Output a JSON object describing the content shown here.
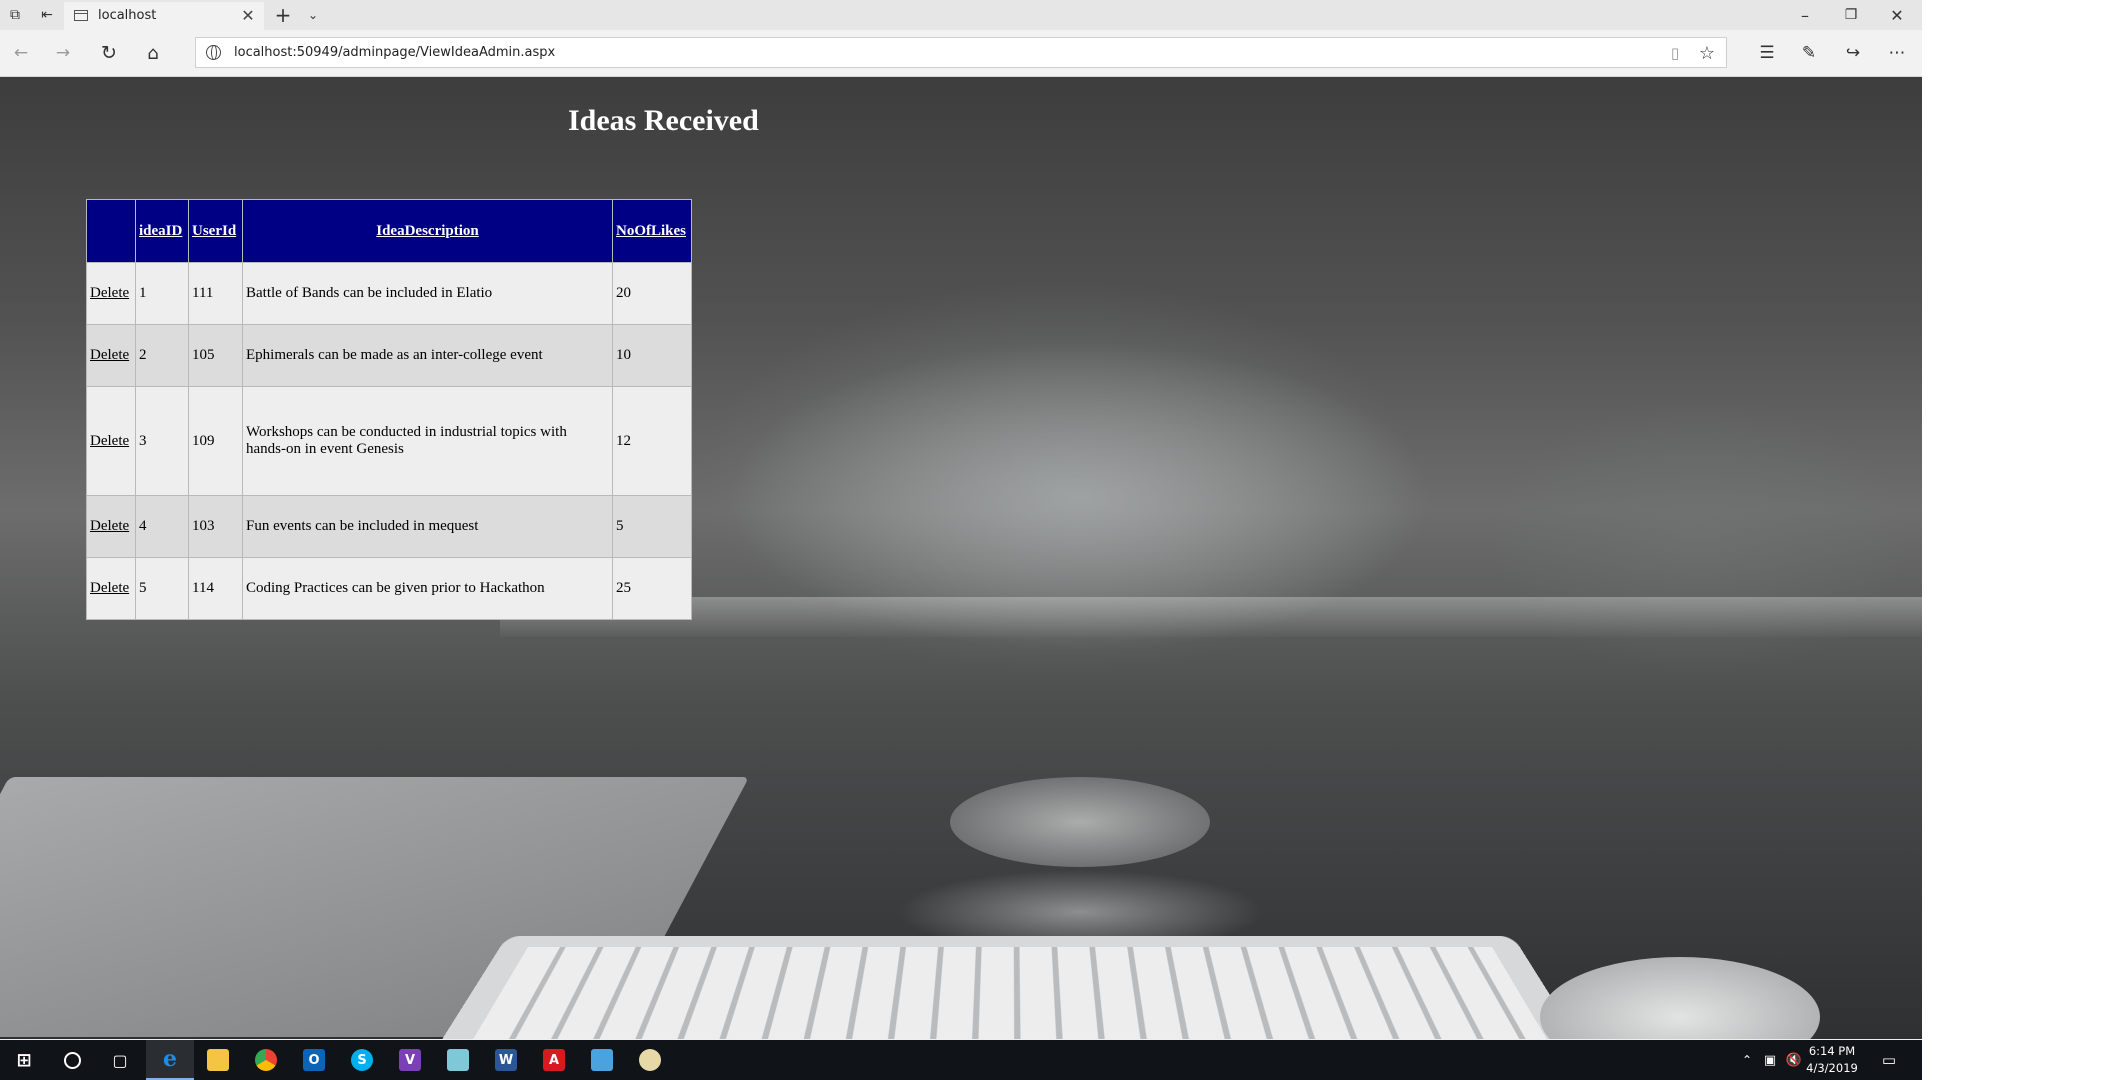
{
  "browser": {
    "tab_title": "localhost",
    "url": "localhost:50949/adminpage/ViewIdeaAdmin.aspx"
  },
  "page": {
    "title": "Ideas Received"
  },
  "table": {
    "headers": [
      "",
      "ideaID",
      "UserId",
      "IdeaDescription",
      "NoOfLikes"
    ],
    "delete_label": "Delete",
    "rows": [
      {
        "ideaID": "1",
        "UserId": "111",
        "IdeaDescription": "Battle of Bands can be included in Elatio",
        "NoOfLikes": "20"
      },
      {
        "ideaID": "2",
        "UserId": "105",
        "IdeaDescription": "Ephimerals can be made as an inter-college event",
        "NoOfLikes": "10"
      },
      {
        "ideaID": "3",
        "UserId": "109",
        "IdeaDescription": "Workshops can be conducted in industrial topics with hands-on in event Genesis",
        "NoOfLikes": "12"
      },
      {
        "ideaID": "4",
        "UserId": "103",
        "IdeaDescription": "Fun events can be included in mequest",
        "NoOfLikes": "5"
      },
      {
        "ideaID": "5",
        "UserId": "114",
        "IdeaDescription": "Coding Practices can be given prior to Hackathon",
        "NoOfLikes": "25"
      }
    ]
  },
  "taskbar": {
    "time": "6:14 PM",
    "date": "4/3/2019"
  },
  "colors": {
    "header_bg": "#000084",
    "row_odd": "#eeeeee",
    "row_even": "#dcdcdc",
    "taskbar_bg": "#101418"
  }
}
